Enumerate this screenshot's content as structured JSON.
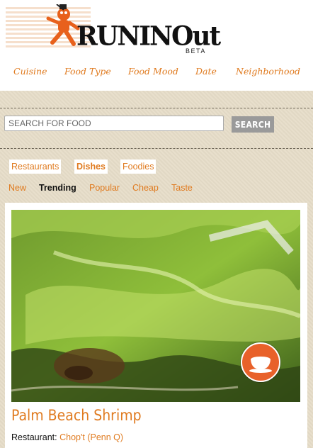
{
  "brand": {
    "logo_text": "RUNINOut",
    "beta_label": "BETA"
  },
  "nav": {
    "items": [
      "Cuisine",
      "Food Type",
      "Food Mood",
      "Date",
      "Neighborhood"
    ]
  },
  "search": {
    "placeholder": "SEARCH FOR FOOD",
    "button_label": "SEARCH"
  },
  "category_tabs": {
    "items": [
      "Restaurants",
      "Dishes",
      "Foodies"
    ],
    "active": "Dishes"
  },
  "filters": {
    "items": [
      "New",
      "Trending",
      "Popular",
      "Cheap",
      "Taste"
    ],
    "active": "Trending"
  },
  "dish": {
    "title": "Palm Beach Shrimp",
    "restaurant_label": "Restaurant:",
    "restaurant_name": "Chop't (Penn Q)",
    "badge_icon": "cup-icon"
  },
  "colors": {
    "accent": "#e07b20",
    "badge": "#e8612a",
    "background": "#e6dcc8"
  }
}
